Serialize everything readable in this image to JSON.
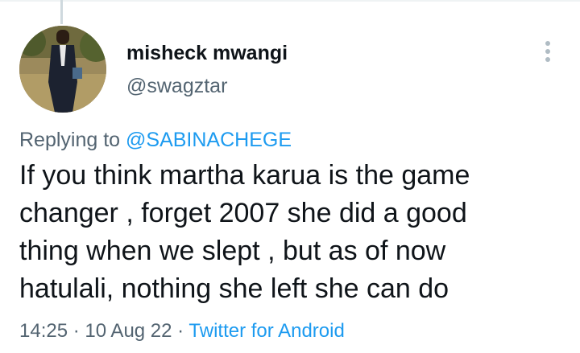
{
  "author": {
    "display_name": "misheck mwangi",
    "handle": "@swagztar"
  },
  "tweet": {
    "replying_prefix": "Replying to ",
    "replying_to": "@SABINACHEGE",
    "text_lines": [
      "If you think martha karua is the game",
      "changer , forget 2007 she did a good",
      "thing when we slept , but as of now",
      "hatulali, nothing she left she can do"
    ],
    "time": "14:25",
    "date": "10 Aug 22",
    "separator": " · ",
    "source": "Twitter for Android"
  },
  "icons": {
    "more": "more-vertical-icon"
  },
  "colors": {
    "link": "#1d9bf0",
    "secondary_text": "#536471",
    "primary_text": "#0f1419"
  }
}
